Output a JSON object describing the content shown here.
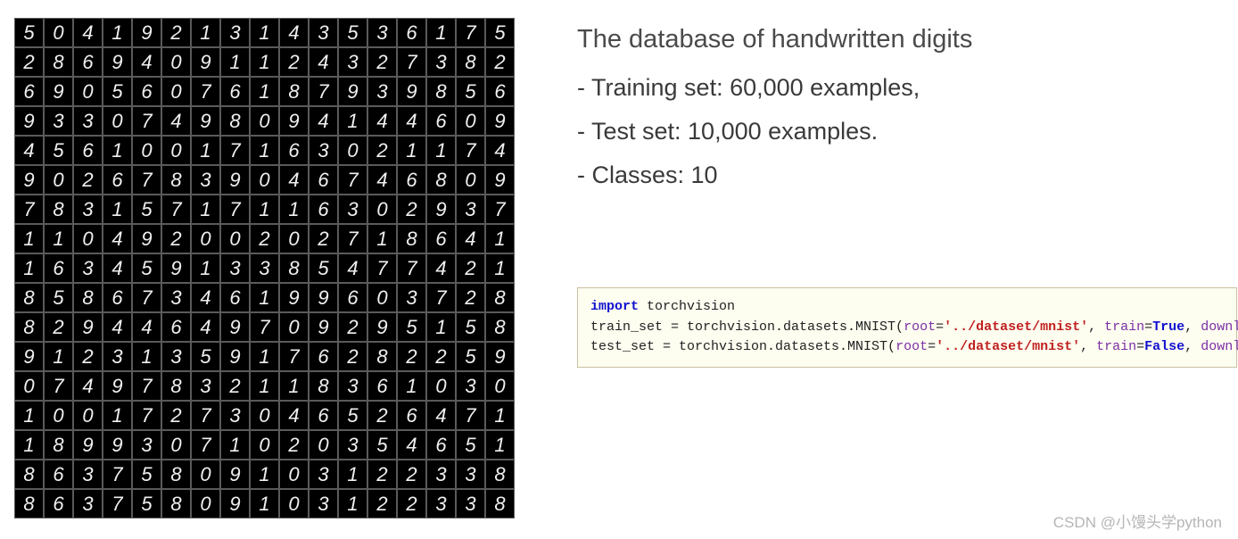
{
  "digits": [
    [
      5,
      0,
      4,
      1,
      9,
      2,
      1,
      3,
      1,
      4,
      3,
      5,
      3,
      6,
      1,
      7
    ],
    [
      2,
      8,
      6,
      9,
      4,
      0,
      9,
      1,
      1,
      2,
      4,
      3,
      2,
      7,
      3,
      8
    ],
    [
      6,
      9,
      0,
      5,
      6,
      0,
      7,
      6,
      1,
      8,
      7,
      9,
      3,
      9,
      8,
      5
    ],
    [
      9,
      3,
      3,
      0,
      7,
      4,
      9,
      8,
      0,
      9,
      4,
      1,
      4,
      4,
      6,
      0
    ],
    [
      4,
      5,
      6,
      1,
      0,
      0,
      1,
      7,
      1,
      6,
      3,
      0,
      2,
      1,
      1,
      7
    ],
    [
      9,
      0,
      2,
      6,
      7,
      8,
      3,
      9,
      0,
      4,
      6,
      7,
      4,
      6,
      8,
      0
    ],
    [
      7,
      8,
      3,
      1,
      5,
      7,
      1,
      7,
      1,
      1,
      6,
      3,
      0,
      2,
      9,
      3
    ],
    [
      1,
      1,
      0,
      4,
      9,
      2,
      0,
      0,
      2,
      0,
      2,
      7,
      1,
      8,
      6,
      4
    ],
    [
      1,
      6,
      3,
      4,
      5,
      9,
      1,
      3,
      3,
      8,
      5,
      4,
      7,
      7,
      4,
      2
    ],
    [
      8,
      5,
      8,
      6,
      7,
      3,
      4,
      6,
      1,
      9,
      9,
      6,
      0,
      3,
      7,
      2
    ],
    [
      8,
      2,
      9,
      4,
      4,
      6,
      4,
      9,
      7,
      0,
      9,
      2,
      9,
      5,
      1,
      5
    ],
    [
      9,
      1,
      2,
      3,
      1,
      3,
      5,
      9,
      1,
      7,
      6,
      2,
      8,
      2,
      2,
      5
    ],
    [
      0,
      7,
      4,
      9,
      7,
      8,
      3,
      2,
      1,
      1,
      8,
      3,
      6,
      1,
      0,
      3
    ],
    [
      1,
      0,
      0,
      1,
      7,
      2,
      7,
      3,
      0,
      4,
      6,
      5,
      2,
      6,
      4,
      7
    ],
    [
      1,
      8,
      9,
      9,
      3,
      0,
      7,
      1,
      0,
      2,
      0,
      3,
      5,
      4,
      6,
      5
    ],
    [
      8,
      6,
      3,
      7,
      5,
      8,
      0,
      9,
      1,
      0,
      3,
      1,
      2,
      2,
      3,
      3
    ]
  ],
  "description": {
    "title": "The database of handwritten digits",
    "lines": [
      "- Training set: 60,000 examples,",
      "- Test set: 10,000 examples.",
      "- Classes: 10"
    ]
  },
  "code": {
    "line1_kw": "import",
    "line1_mod": " torchvision",
    "line2_pre": "train_set = torchvision.datasets.MNIST(",
    "line3_pre": "test_set  = torchvision.datasets.MNIST(",
    "param_root": "root",
    "eq": "=",
    "root_val": "'../dataset/mnist'",
    "comma": ", ",
    "param_train": " train",
    "val_true": "True",
    "val_false": "False",
    "param_download": "  download",
    "close": ")"
  },
  "watermark": "CSDN @小馒头学python"
}
